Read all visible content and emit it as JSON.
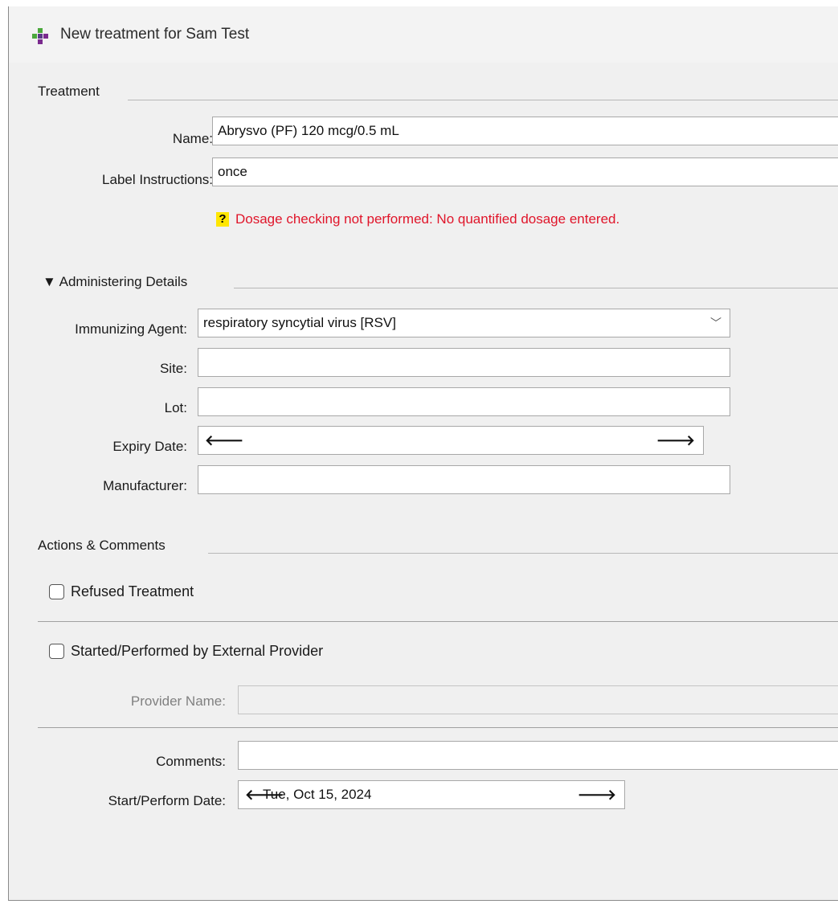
{
  "window": {
    "title": "New treatment for Sam Test",
    "icon": "pharmacy-cross-icon"
  },
  "treatment": {
    "section_title": "Treatment",
    "name_label": "Name:",
    "name_value": "Abrysvo (PF) 120 mcg/0.5 mL",
    "label_instructions_label": "Label Instructions:",
    "label_instructions_value": "once",
    "warning_icon": "?",
    "warning_text": "Dosage checking not performed: No quantified dosage entered.",
    "warning_color": "#e0152a"
  },
  "administering": {
    "section_title": "▼ Administering Details",
    "immunizing_agent_label": "Immunizing Agent:",
    "immunizing_agent_value": "respiratory syncytial virus [RSV]",
    "site_label": "Site:",
    "site_value": "",
    "lot_label": "Lot:",
    "lot_value": "",
    "expiry_date_label": "Expiry Date:",
    "expiry_date_value": "",
    "manufacturer_label": "Manufacturer:",
    "manufacturer_value": ""
  },
  "actions": {
    "section_title": "Actions & Comments",
    "refused_treatment_label": "Refused Treatment",
    "refused_treatment_checked": false,
    "external_provider_label": "Started/Performed by External Provider",
    "external_provider_checked": false,
    "provider_name_label": "Provider Name:",
    "provider_name_value": "",
    "comments_label": "Comments:",
    "comments_value": "",
    "start_date_label": "Start/Perform Date:",
    "start_date_value": "Tue, Oct 15, 2024"
  },
  "glyphs": {
    "arrow_left": "🡐",
    "arrow_right": "🡒",
    "chevron_down": "﹀"
  }
}
